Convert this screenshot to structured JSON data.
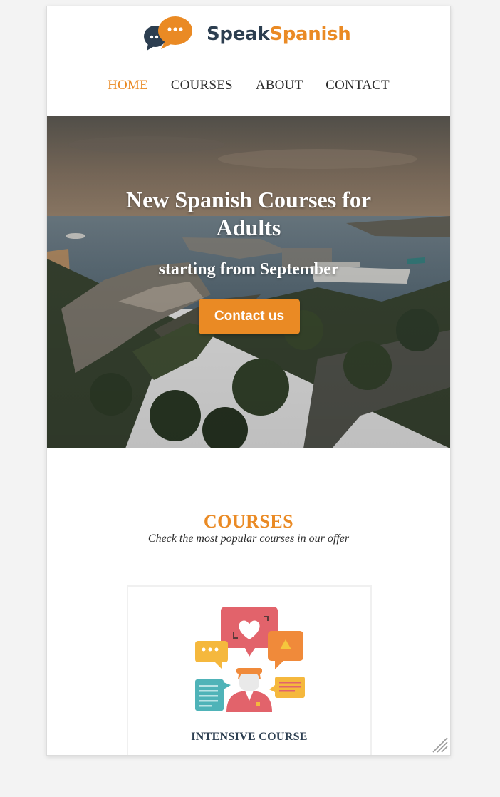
{
  "brand": {
    "word1": "Speak",
    "word2": "Spanish",
    "primary": "#2c3e50",
    "accent": "#ea8a24"
  },
  "nav": {
    "items": [
      {
        "label": "HOME",
        "active": true
      },
      {
        "label": "COURSES",
        "active": false
      },
      {
        "label": "ABOUT",
        "active": false
      },
      {
        "label": "CONTACT",
        "active": false
      }
    ]
  },
  "hero": {
    "title": "New Spanish Courses for Adults",
    "subtitle": "starting from September",
    "button_label": "Contact us"
  },
  "courses": {
    "heading": "COURSES",
    "subheading": "Check the most popular courses in our offer",
    "cards": [
      {
        "title": "INTENSIVE COURSE",
        "icon": "chat-people-illustration"
      }
    ]
  }
}
